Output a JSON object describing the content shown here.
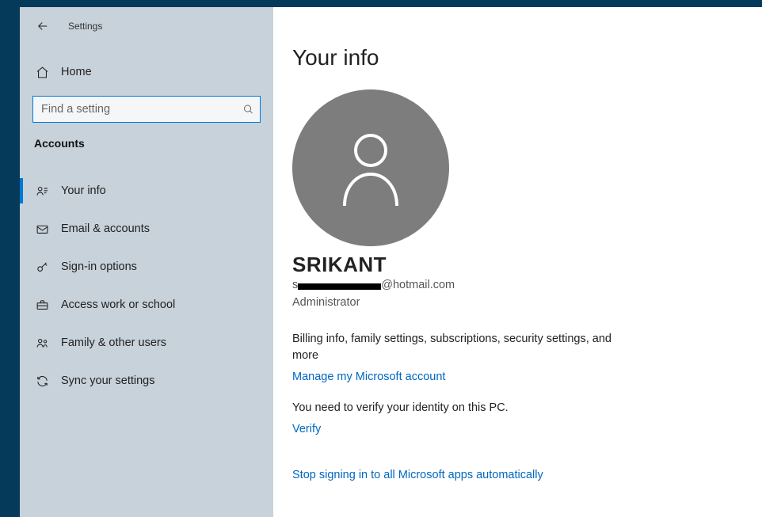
{
  "titlebar": {
    "title": "Settings"
  },
  "sidebar": {
    "home_label": "Home",
    "search_placeholder": "Find a setting",
    "category": "Accounts",
    "items": [
      {
        "label": "Your info",
        "active": true
      },
      {
        "label": "Email & accounts",
        "active": false
      },
      {
        "label": "Sign-in options",
        "active": false
      },
      {
        "label": "Access work or school",
        "active": false
      },
      {
        "label": "Family & other users",
        "active": false
      },
      {
        "label": "Sync your settings",
        "active": false
      }
    ]
  },
  "main": {
    "page_title": "Your info",
    "display_name": "SRIKANT",
    "email_suffix": "@hotmail.com",
    "role": "Administrator",
    "billing_desc": "Billing info, family settings, subscriptions, security settings, and more",
    "manage_link": "Manage my Microsoft account",
    "verify_desc": "You need to verify your identity on this PC.",
    "verify_link": "Verify",
    "stop_signin_link": "Stop signing in to all Microsoft apps automatically"
  }
}
